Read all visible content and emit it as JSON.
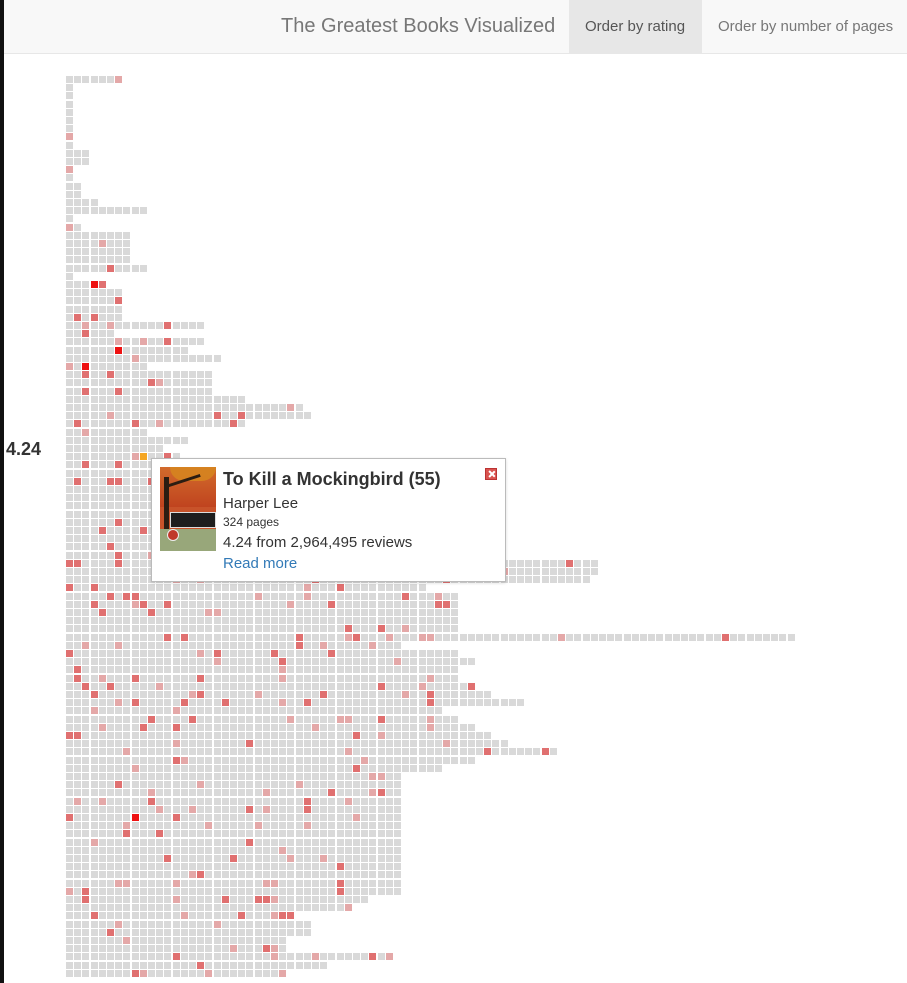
{
  "navbar": {
    "brand": "The Greatest Books Visualized",
    "tabs": [
      {
        "label": "Order by rating",
        "active": true
      },
      {
        "label": "Order by number of pages",
        "active": false
      }
    ]
  },
  "rating_label": "4.24",
  "popup": {
    "title": "To Kill a Mockingbird (55)",
    "author": "Harper Lee",
    "pages": "324 pages",
    "stats": "4.24 from 2,964,495 reviews",
    "link": "Read more",
    "close_icon": "close-icon"
  },
  "colors": {
    "cell": "#d9d9d9",
    "highlight_light": "#e4a8a8",
    "highlight_mid": "#e07070",
    "highlight_strong": "#ee1111",
    "selected": "#f5a623",
    "link": "#337ab7"
  }
}
